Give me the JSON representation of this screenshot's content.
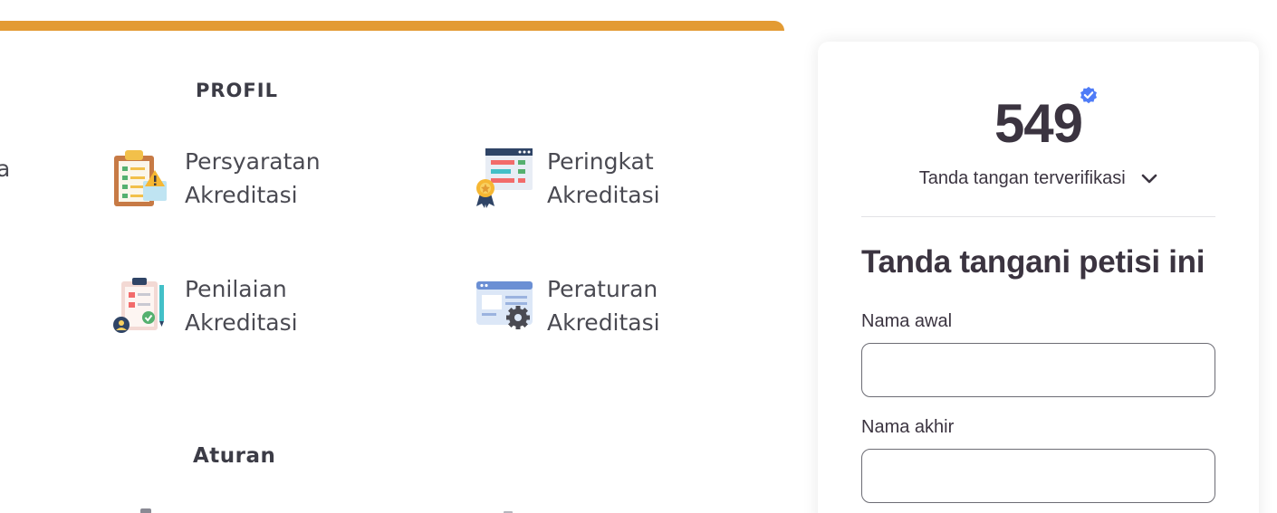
{
  "accreditation_panel": {
    "profile_heading": "PROFIL",
    "rules_heading": "Aturan",
    "cut_off_text": "a",
    "items": [
      {
        "line1": "Persyaratan",
        "line2": "Akreditasi",
        "icon": "clipboard-requirements-icon"
      },
      {
        "line1": "Peringkat",
        "line2": "Akreditasi",
        "icon": "ranking-award-icon"
      },
      {
        "line1": "Penilaian",
        "line2": "Akreditasi",
        "icon": "assessment-checklist-icon"
      },
      {
        "line1": "Peraturan",
        "line2": "Akreditasi",
        "icon": "regulation-settings-icon"
      }
    ],
    "accent_color": "#e39b33"
  },
  "petition": {
    "signature_count": "549",
    "verified_label": "Tanda tangan terverifikasi",
    "form_title": "Tanda tangani petisi ini",
    "first_name_label": "Nama awal",
    "first_name_value": "",
    "last_name_label": "Nama akhir",
    "last_name_value": "",
    "verified_color": "#4f7cf7"
  }
}
